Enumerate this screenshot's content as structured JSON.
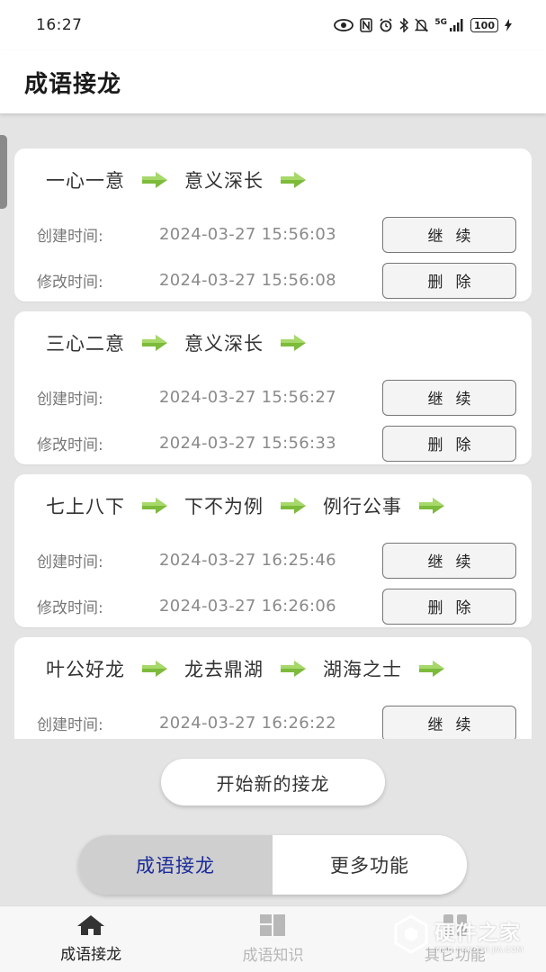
{
  "status_bar": {
    "time": "16:27",
    "network": "5G",
    "battery": "100"
  },
  "header": {
    "title": "成语接龙"
  },
  "records": [
    {
      "chain": [
        "一心一意",
        "意义深长"
      ],
      "created_label": "创建时间:",
      "created_value": "2024-03-27 15:56:03",
      "modified_label": "修改时间:",
      "modified_value": "2024-03-27 15:56:08",
      "continue_label": "继续",
      "delete_label": "删除"
    },
    {
      "chain": [
        "三心二意",
        "意义深长"
      ],
      "created_label": "创建时间:",
      "created_value": "2024-03-27 15:56:27",
      "modified_label": "修改时间:",
      "modified_value": "2024-03-27 15:56:33",
      "continue_label": "继续",
      "delete_label": "删除"
    },
    {
      "chain": [
        "七上八下",
        "下不为例",
        "例行公事"
      ],
      "created_label": "创建时间:",
      "created_value": "2024-03-27 16:25:46",
      "modified_label": "修改时间:",
      "modified_value": "2024-03-27 16:26:06",
      "continue_label": "继续",
      "delete_label": "删除"
    },
    {
      "chain": [
        "叶公好龙",
        "龙去鼎湖",
        "湖海之士"
      ],
      "created_label": "创建时间:",
      "created_value": "2024-03-27 16:26:22",
      "continue_label": "继续"
    }
  ],
  "new_chain_button": "开始新的接龙",
  "segment": {
    "left": "成语接龙",
    "right": "更多功能"
  },
  "bottom_nav": [
    {
      "label": "成语接龙",
      "icon": "home-icon"
    },
    {
      "label": "成语知识",
      "icon": "grid-icon"
    },
    {
      "label": "其它功能",
      "icon": "apps-icon"
    }
  ],
  "watermark": {
    "main": "硬件之家",
    "sub": "YING JIAN ZHI JIA.COM"
  },
  "colors": {
    "arrow": "#7dbb3b",
    "active_tab_text": "#1a2a9a"
  }
}
